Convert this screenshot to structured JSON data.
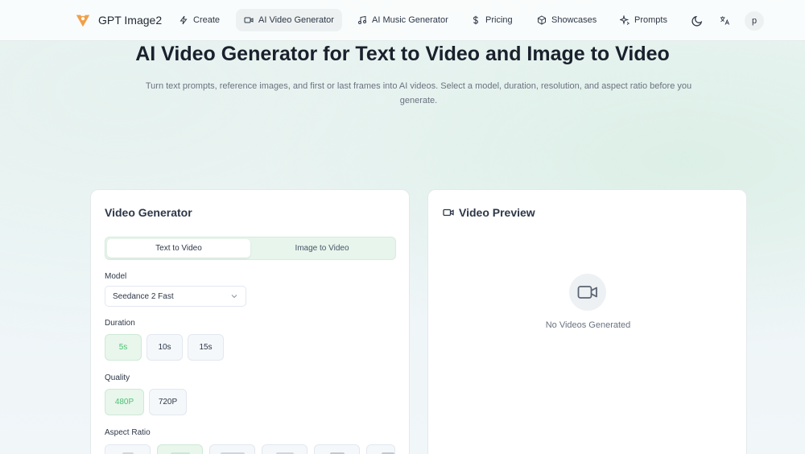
{
  "brand": {
    "name": "GPT Image2",
    "icon": "logo-icon",
    "color": "#f0a04b"
  },
  "nav": [
    {
      "label": "Create",
      "icon": "bolt-icon"
    },
    {
      "label": "AI Video Generator",
      "icon": "video-icon",
      "active": true
    },
    {
      "label": "AI Music Generator",
      "icon": "music-icon"
    },
    {
      "label": "Pricing",
      "icon": "dollar-icon"
    },
    {
      "label": "Showcases",
      "icon": "cube-icon"
    },
    {
      "label": "Prompts",
      "icon": "sparkles-icon"
    }
  ],
  "header_actions": {
    "theme_icon": "moon-icon",
    "language_icon": "translate-icon",
    "avatar_letter": "p"
  },
  "hero": {
    "title": "AI Video Generator for Text to Video and Image to Video",
    "subtitle": "Turn text prompts, reference images, and first or last frames into AI videos. Select a model, duration, resolution, and aspect ratio before you generate."
  },
  "generator": {
    "title": "Video Generator",
    "tabs": [
      {
        "label": "Text to Video",
        "selected": true
      },
      {
        "label": "Image to Video",
        "selected": false
      }
    ],
    "model": {
      "label": "Model",
      "value": "Seedance 2 Fast"
    },
    "duration": {
      "label": "Duration",
      "options": [
        "5s",
        "10s",
        "15s"
      ],
      "selected": "5s"
    },
    "quality": {
      "label": "Quality",
      "options": [
        "480P",
        "720P"
      ],
      "selected": "480P"
    },
    "aspect_ratio": {
      "label": "Aspect Ratio"
    }
  },
  "preview": {
    "title": "Video Preview",
    "icon": "video-icon",
    "empty_text": "No Videos Generated"
  },
  "colors": {
    "accent": "#4fbf74",
    "accent_bg": "#e8f6ec"
  }
}
